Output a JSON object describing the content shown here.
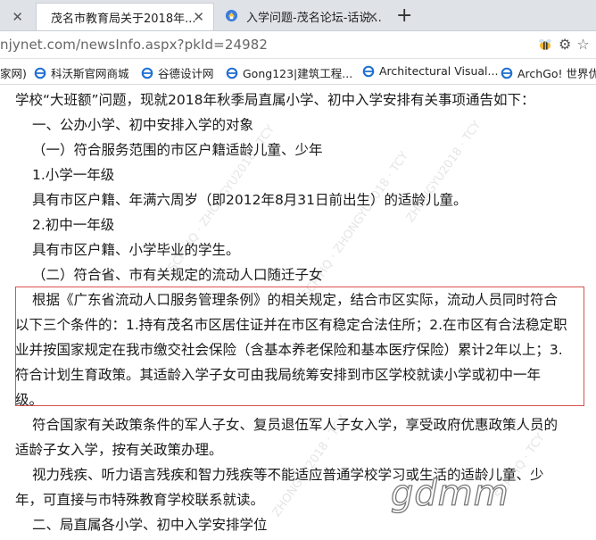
{
  "tabs": {
    "first": {
      "close": "✕"
    },
    "active": {
      "label": "茂名市教育局关于2018年...",
      "close": "✕"
    },
    "second": {
      "label": "入学问题-茂名论坛-话说...",
      "close": "✕"
    },
    "new_tab": "+"
  },
  "address": {
    "url": "njynet.com/newsInfo.aspx?pkId=24982",
    "right_icons": [
      "bee-icon",
      "puzzle-icon",
      "star-icon"
    ]
  },
  "bookmarks": [
    {
      "label": "家网)"
    },
    {
      "label": "科沃斯官网商城"
    },
    {
      "label": "谷德设计网"
    },
    {
      "label": "Gong123|建筑工程..."
    },
    {
      "label": "Architectural Visual..."
    },
    {
      "label": "ArchGo! 世界优"
    }
  ],
  "article": {
    "l1": "学校“大班额”问题，现就2018年秋季局直属小学、初中入学安排有关事项通告如下：",
    "l2": "一、公办小学、初中安排入学的对象",
    "l3": "（一）符合服务范围的市区户籍适龄儿童、少年",
    "l4": "1.小学一年级",
    "l5": "具有市区户籍、年满六周岁（即2012年8月31日前出生）的适龄儿童。",
    "l6": "2.初中一年级",
    "l7": "具有市区户籍、小学毕业的学生。",
    "l8": "（二）符合省、市有关规定的流动人口随迁子女",
    "l9": "根据《广东省流动人口服务管理条例》的相关规定，结合市区实际，流动人员同时符合",
    "l10": "以下三个条件的：1.持有茂名市区居住证并在市区有稳定合法住所；2.在市区有合法稳定职",
    "l11": "业并按国家规定在我市缴交社会保险（含基本养老保险和基本医疗保险）累计2年以上；3.",
    "l12": "符合计划生育政策。其适龄入学子女可由我局统筹安排到市区学校就读小学或初中一年",
    "l13": "级。",
    "l14": "符合国家有关政策条件的军人子女、复员退伍军人子女入学，享受政府优惠政策人员的",
    "l15": "适龄子女入学，按有关政策办理。",
    "l16": "视力残疾、听力语言残疾和智力残疾等不能适应普通学校学习或生活的适龄儿童、少",
    "l17": "年，可直接与市特殊教育学校联系就读。",
    "l18": "二、局直属各小学、初中入学安排学位"
  },
  "watermark": {
    "site": "gdmm"
  },
  "colors": {
    "highlight_border": "#d9534f",
    "tabbar": "#dfe3e8"
  }
}
